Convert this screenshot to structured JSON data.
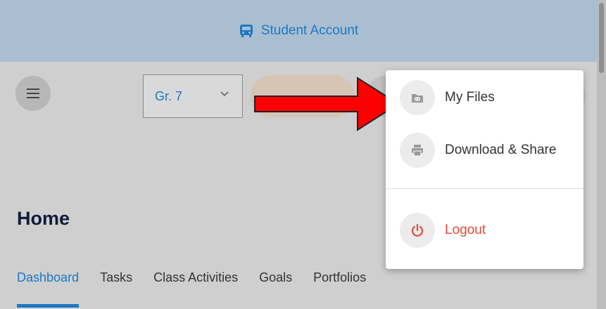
{
  "banner": {
    "label": "Student Account",
    "icon": "bus-icon",
    "color": "#1c78c4"
  },
  "toolbar": {
    "menu_icon": "hamburger-icon",
    "grade": {
      "selected": "Gr. 7"
    }
  },
  "page": {
    "title": "Home"
  },
  "tabs": [
    {
      "label": "Dashboard",
      "active": true
    },
    {
      "label": "Tasks"
    },
    {
      "label": "Class Activities"
    },
    {
      "label": "Goals"
    },
    {
      "label": "Portfolios"
    }
  ],
  "dropdown": {
    "items": [
      {
        "label": "My Files",
        "icon": "folder-link-icon"
      },
      {
        "label": "Download & Share",
        "icon": "printer-icon"
      },
      {
        "label": "Logout",
        "icon": "power-icon",
        "color": "#e04a3c"
      }
    ]
  },
  "annotation": {
    "arrow_color": "#ff0000"
  }
}
